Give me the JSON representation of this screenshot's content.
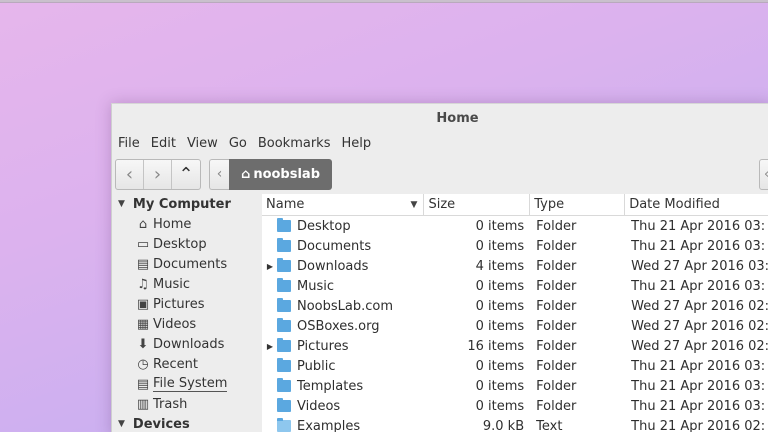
{
  "window": {
    "title": "Home"
  },
  "menu": [
    "File",
    "Edit",
    "View",
    "Go",
    "Bookmarks",
    "Help"
  ],
  "toolbar": {
    "back_glyph": "‹",
    "forward_glyph": "›",
    "up_glyph": "⌃",
    "crumb_left_glyph": "‹",
    "location": "noobslab",
    "home_glyph": "⌂"
  },
  "sidebar": {
    "section1": "My Computer",
    "section2": "Devices",
    "items": [
      {
        "label": "Home",
        "icon": "home-icon",
        "glyph": "⌂"
      },
      {
        "label": "Desktop",
        "icon": "desktop-icon",
        "glyph": "▭"
      },
      {
        "label": "Documents",
        "icon": "documents-icon",
        "glyph": "▤"
      },
      {
        "label": "Music",
        "icon": "headphones-icon",
        "glyph": "♫"
      },
      {
        "label": "Pictures",
        "icon": "camera-icon",
        "glyph": "▣"
      },
      {
        "label": "Videos",
        "icon": "film-icon",
        "glyph": "▦"
      },
      {
        "label": "Downloads",
        "icon": "download-icon",
        "glyph": "⬇"
      },
      {
        "label": "Recent",
        "icon": "clock-icon",
        "glyph": "◷"
      },
      {
        "label": "File System",
        "icon": "drive-icon",
        "glyph": "▤"
      },
      {
        "label": "Trash",
        "icon": "trash-icon",
        "glyph": "▥"
      }
    ]
  },
  "columns": {
    "name": "Name",
    "size": "Size",
    "type": "Type",
    "date": "Date Modified"
  },
  "files": [
    {
      "name": "Desktop",
      "size": "0 items",
      "type": "Folder",
      "date": "Thu 21 Apr 2016 03:",
      "expandable": false,
      "kind": "folder"
    },
    {
      "name": "Documents",
      "size": "0 items",
      "type": "Folder",
      "date": "Thu 21 Apr 2016 03:",
      "expandable": false,
      "kind": "folder"
    },
    {
      "name": "Downloads",
      "size": "4 items",
      "type": "Folder",
      "date": "Wed 27 Apr 2016 03:",
      "expandable": true,
      "kind": "folder"
    },
    {
      "name": "Music",
      "size": "0 items",
      "type": "Folder",
      "date": "Thu 21 Apr 2016 03:",
      "expandable": false,
      "kind": "folder"
    },
    {
      "name": "NoobsLab.com",
      "size": "0 items",
      "type": "Folder",
      "date": "Wed 27 Apr 2016 02:",
      "expandable": false,
      "kind": "folder"
    },
    {
      "name": "OSBoxes.org",
      "size": "0 items",
      "type": "Folder",
      "date": "Wed 27 Apr 2016 02:",
      "expandable": false,
      "kind": "folder"
    },
    {
      "name": "Pictures",
      "size": "16 items",
      "type": "Folder",
      "date": "Wed 27 Apr 2016 02:",
      "expandable": true,
      "kind": "folder"
    },
    {
      "name": "Public",
      "size": "0 items",
      "type": "Folder",
      "date": "Thu 21 Apr 2016 03:",
      "expandable": false,
      "kind": "folder"
    },
    {
      "name": "Templates",
      "size": "0 items",
      "type": "Folder",
      "date": "Thu 21 Apr 2016 03:",
      "expandable": false,
      "kind": "folder"
    },
    {
      "name": "Videos",
      "size": "0 items",
      "type": "Folder",
      "date": "Thu 21 Apr 2016 03:",
      "expandable": false,
      "kind": "folder"
    },
    {
      "name": "Examples",
      "size": "9.0 kB",
      "type": "Text",
      "date": "Thu 21 Apr 2016 02:",
      "expandable": false,
      "kind": "text"
    }
  ]
}
